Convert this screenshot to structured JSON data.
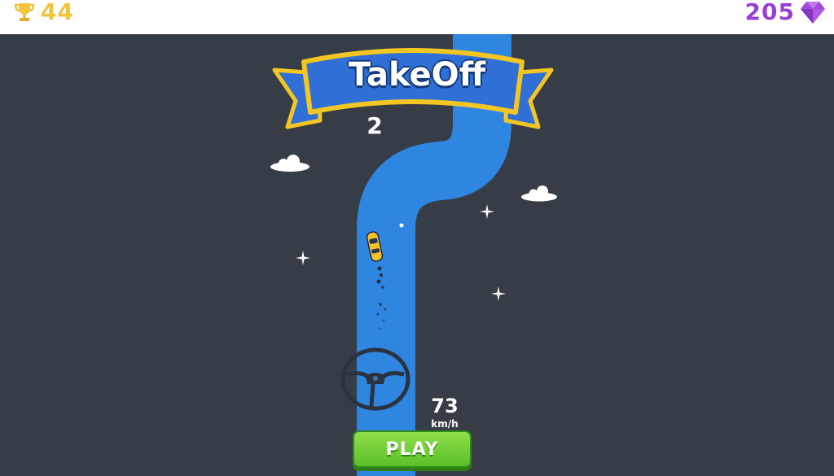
{
  "hud": {
    "trophy_count": "44",
    "gem_count": "205"
  },
  "banner": {
    "title": "TakeOff"
  },
  "level": {
    "number": "2"
  },
  "speed": {
    "value": "73",
    "unit": "km/h"
  },
  "play_button": {
    "label": "PLAY"
  },
  "colors": {
    "background": "#363d46",
    "road": "#2f86e0",
    "trophy": "#f2c33b",
    "gem": "#9a3fd0",
    "play_button": "#6fcb32",
    "banner_blue": "#2f6fd6",
    "banner_gold": "#f4c623"
  },
  "icons": [
    "trophy-icon",
    "gem-icon",
    "cloud-icon",
    "sparkle-icon",
    "car-icon",
    "steering-wheel-icon"
  ]
}
